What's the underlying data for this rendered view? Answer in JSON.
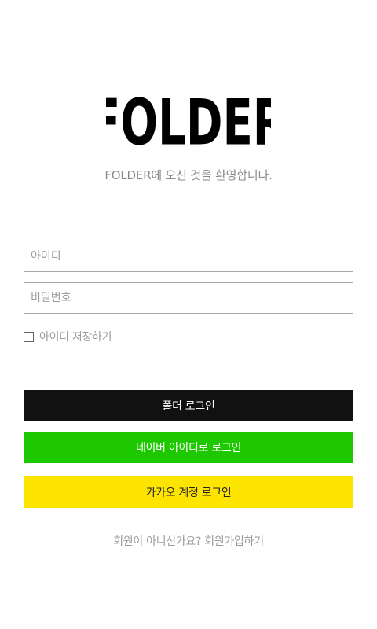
{
  "brand": {
    "logo_text": "FOLDER",
    "logo_color": "#000000"
  },
  "welcome_text": "FOLDER에 오신 것을 환영합니다.",
  "login_form": {
    "id_placeholder": "아이디",
    "id_value": "",
    "password_placeholder": "비밀번호",
    "password_value": "",
    "remember_label": "아이디 저장하기",
    "remember_checked": false
  },
  "buttons": {
    "folder_login": {
      "label": "폴더 로그인",
      "bg": "#111111",
      "fg": "#ffffff"
    },
    "naver_login": {
      "label": "네이버 아이디로 로그인",
      "bg": "#1ec800",
      "fg": "#ffffff"
    },
    "kakao_login": {
      "label": "카카오 계정 로그인",
      "bg": "#fee500",
      "fg": "#222222"
    }
  },
  "signup": {
    "prompt": "회원이 아니신가요?",
    "link_label": "회원가입하기"
  }
}
